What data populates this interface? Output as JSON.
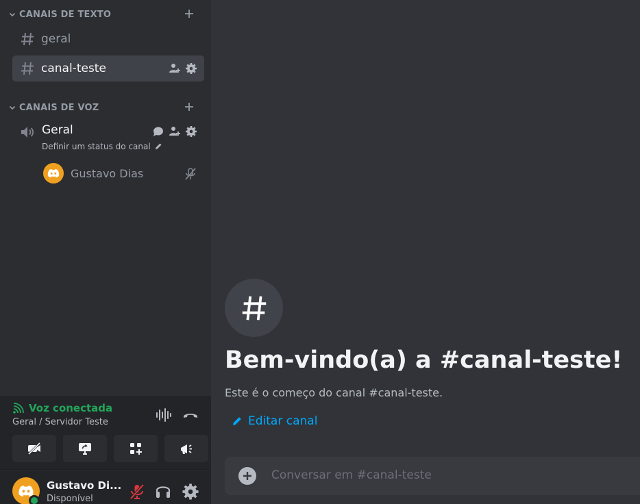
{
  "sidebar": {
    "text_category": "CANAIS DE TEXTO",
    "voice_category": "CANAIS DE VOZ",
    "text_channels": [
      {
        "label": "geral",
        "active": false
      },
      {
        "label": "canal-teste",
        "active": true
      }
    ],
    "voice_channel": {
      "label": "Geral",
      "status_placeholder": "Definir um status do canal",
      "members": [
        {
          "name": "Gustavo Dias",
          "muted": true
        }
      ]
    }
  },
  "voice_panel": {
    "title": "Voz conectada",
    "subtitle": "Geral / Servidor Teste"
  },
  "user_panel": {
    "name": "Gustavo Di...",
    "status": "Disponível"
  },
  "main": {
    "welcome_title": "Bem-vindo(a) a #canal-teste!",
    "welcome_subtitle": "Este é o começo do canal #canal-teste.",
    "edit_link": "Editar canal",
    "composer_placeholder": "Conversar em #canal-teste"
  },
  "colors": {
    "sidebar_bg": "#2b2d31",
    "main_bg": "#313338",
    "panel_bg": "#232428",
    "active_channel_bg": "#404249",
    "connected_green": "#23a55a",
    "link_blue": "#00a8fc",
    "mute_red": "#da373c",
    "avatar_orange": "#f0a020"
  }
}
